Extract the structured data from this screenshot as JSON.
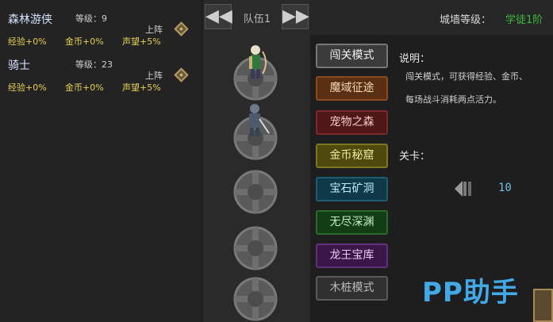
{
  "heroes": [
    {
      "name": "森林游侠",
      "level": "等级：9",
      "deploy": "上阵",
      "exp": "经验+0%",
      "gold": "金币+0%",
      "fame": "声望+5%"
    },
    {
      "name": "骑士",
      "level": "等级：23",
      "deploy": "上阵",
      "exp": "经验+0%",
      "gold": "金币+0%",
      "fame": "声望+5%"
    }
  ],
  "team": {
    "title": "队伍1",
    "prev": "◀◀",
    "next": "▶▶"
  },
  "header": {
    "wall_label": "城墙等级：",
    "wall_value": "学徒1阶"
  },
  "modes": [
    {
      "label": "闯关模式",
      "bg": "#3b3b3b",
      "fg": "#f2f2f2",
      "border": "#777777"
    },
    {
      "label": "魔域征途",
      "bg": "#5a2f12",
      "fg": "#f2d9b8",
      "border": "#8a4a22"
    },
    {
      "label": "宠物之森",
      "bg": "#4f1718",
      "fg": "#f2c8c8",
      "border": "#7a2a2a"
    },
    {
      "label": "金币秘窟",
      "bg": "#4e4a0d",
      "fg": "#f0ea9a",
      "border": "#7e7620"
    },
    {
      "label": "宝石矿洞",
      "bg": "#0f3848",
      "fg": "#bfeaf8",
      "border": "#1f5c72"
    },
    {
      "label": "无尽深渊",
      "bg": "#123d15",
      "fg": "#c2f0c0",
      "border": "#2a6a2c"
    },
    {
      "label": "龙王宝库",
      "bg": "#3a1748",
      "fg": "#e8c8f4",
      "border": "#60307a"
    },
    {
      "label": "木桩模式",
      "bg": "#303030",
      "fg": "#bdbdbd",
      "border": "#5a5a5a"
    }
  ],
  "info": {
    "title": "说明：",
    "line1": "闯关模式，可获得经验、金币、",
    "line2": "每场战斗消耗两点活力。",
    "stage_label": "关卡：",
    "stage_value": "10"
  },
  "watermark": "PP助手",
  "colors": {
    "gold": "#e6cf55",
    "cyan": "#6ec0e4",
    "green": "#3dbb3d"
  }
}
